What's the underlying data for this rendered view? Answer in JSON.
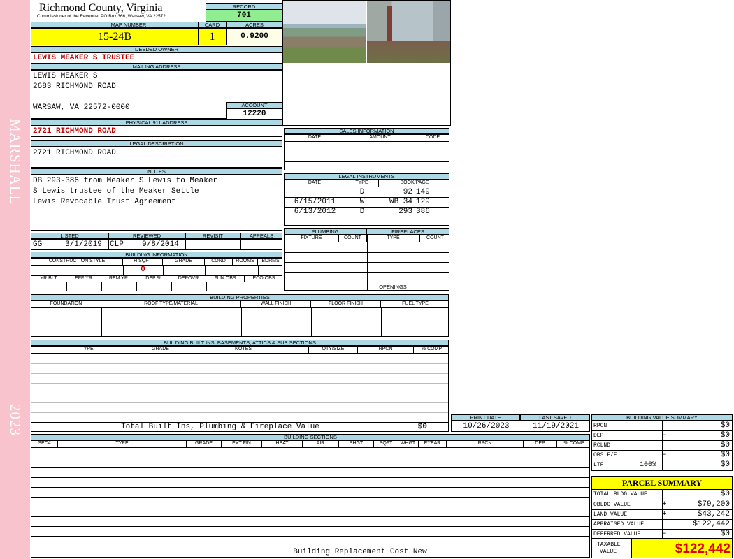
{
  "side": {
    "district": "MARSHALL",
    "year": "2023"
  },
  "header": {
    "county": "Richmond County, Virginia",
    "commissioner": "Commissioner of the Revenue, PO Box 366, Warsaw, VA 22572",
    "record_label": "RECORD",
    "record": "701",
    "map_number_label": "MAP NUMBER",
    "map_number": "15-24B",
    "card_label": "CARD",
    "card": "1",
    "acres_label": "ACRES",
    "acres": "0.9200"
  },
  "owner": {
    "label": "DEEDED OWNER",
    "name": "LEWIS MEAKER S TRUSTEE"
  },
  "mailing": {
    "label": "MAILING ADDRESS",
    "line1": "LEWIS MEAKER S",
    "line2": "2683 RICHMOND ROAD",
    "line3": "WARSAW, VA 22572-0000"
  },
  "account": {
    "label": "ACCOUNT",
    "value": "12220"
  },
  "physical": {
    "label": "PHYSICAL 911 ADDRESS",
    "value": "2721 RICHMOND ROAD"
  },
  "legal_desc": {
    "label": "LEGAL DESCRIPTION",
    "value": "2721 RICHMOND ROAD"
  },
  "notes": {
    "label": "NOTES",
    "line1": "DB 293-386 from Meaker S Lewis to Meaker",
    "line2": "S Lewis trustee of the Meaker Settle",
    "line3": "Lewis Revocable Trust Agreement"
  },
  "review": {
    "listed_label": "LISTED",
    "reviewed_label": "REVIEWED",
    "revisit_label": "REVISIT",
    "appeals_label": "APPEALS",
    "listed_by": "GG",
    "listed_date": "3/1/2019",
    "reviewed_by": "CLP",
    "reviewed_date": "9/8/2014"
  },
  "building_info": {
    "label": "BUILDING INFORMATION",
    "cols1": [
      "CONSTRUCTION STYLE",
      "H SQFT",
      "GRADE",
      "COND",
      "ROOMS",
      "BDRMS"
    ],
    "hsqft": "0",
    "cols2": [
      "YR BLT",
      "EFF YR",
      "REM YR",
      "DEP %",
      "DEPOVR",
      "FUN OBS",
      "ECO OBS"
    ]
  },
  "sales": {
    "label": "SALES INFORMATION",
    "cols": [
      "DATE",
      "AMOUNT",
      "CODE"
    ]
  },
  "legal_instruments": {
    "label": "LEGAL INSTRUMENTS",
    "cols": [
      "DATE",
      "TYPE",
      "BOOK/PAGE"
    ],
    "rows": [
      {
        "date": "",
        "type": "D",
        "book": "92",
        "page": "149"
      },
      {
        "date": "6/15/2011",
        "type": "W",
        "book": "WB 34",
        "page": "129"
      },
      {
        "date": "6/13/2012",
        "type": "D",
        "book": "293",
        "page": "386"
      }
    ]
  },
  "plumbing": {
    "label": "PLUMBING",
    "cols": [
      "FIXTURE",
      "COUNT"
    ]
  },
  "fireplaces": {
    "label": "FIREPLACES",
    "cols": [
      "TYPE",
      "COUNT"
    ],
    "openings": "OPENINGS"
  },
  "building_props": {
    "label": "BUILDING PROPERTIES",
    "cols": [
      "FOUNDATION",
      "ROOF TYPE/MATERIAL",
      "WALL FINISH",
      "FLOOR FINISH",
      "FUEL TYPE"
    ]
  },
  "built_ins": {
    "label": "BUILDING BUILT INS, BASEMENTS, ATTICS & SUB SECTIONS",
    "cols": [
      "TYPE",
      "GRADE",
      "NOTES",
      "QTY/SIZE",
      "RPCN",
      "% COMP"
    ],
    "total_label": "Total Built Ins, Plumbing & Fireplace Value",
    "total_value": "$0"
  },
  "dates": {
    "print_label": "PRINT DATE",
    "print_date": "10/26/2023",
    "saved_label": "LAST SAVED",
    "saved_date": "11/19/2021"
  },
  "sections": {
    "label": "BUILDING SECTIONS",
    "cols": [
      "SEC#",
      "TYPE",
      "GRADE",
      "EXT FIN",
      "HEAT",
      "AIR",
      "SHGT",
      "SQFT",
      "WHGT",
      "EYEAR",
      "RPCN",
      "DEP",
      "% COMP"
    ],
    "footer": "Building Replacement Cost New"
  },
  "bvs": {
    "label": "BUILDING VALUE SUMMARY",
    "rows": [
      {
        "label": "RPCN",
        "sign": "",
        "value": "$0"
      },
      {
        "label": "DEP",
        "sign": "–",
        "value": "$0"
      },
      {
        "label": "RCLND",
        "sign": "",
        "value": "$0"
      },
      {
        "label": "OBS F/E",
        "sign": "–",
        "value": "$0"
      },
      {
        "label": "LTF",
        "sign": "100%",
        "value": "$0"
      }
    ]
  },
  "parcel": {
    "title": "PARCEL SUMMARY",
    "rows": [
      {
        "label": "TOTAL BLDG VALUE",
        "sign": "",
        "value": "$0"
      },
      {
        "label": "OBLDG VALUE",
        "sign": "+",
        "value": "$79,200"
      },
      {
        "label": "LAND VALUE",
        "sign": "+",
        "value": "$43,242"
      },
      {
        "label": "APPRAISED VALUE",
        "sign": "",
        "value": "$122,442"
      },
      {
        "label": "DEFERRED VALUE",
        "sign": "–",
        "value": "$0"
      }
    ],
    "taxable_label1": "TAXABLE",
    "taxable_label2": "VALUE",
    "taxable_value": "$122,442"
  },
  "colors": {
    "highlight_yellow": "#ffff00",
    "record_green": "#90ee90",
    "header_blue": "#add8e6",
    "side_pink": "#f8c3cd",
    "value_red": "#c00000"
  }
}
